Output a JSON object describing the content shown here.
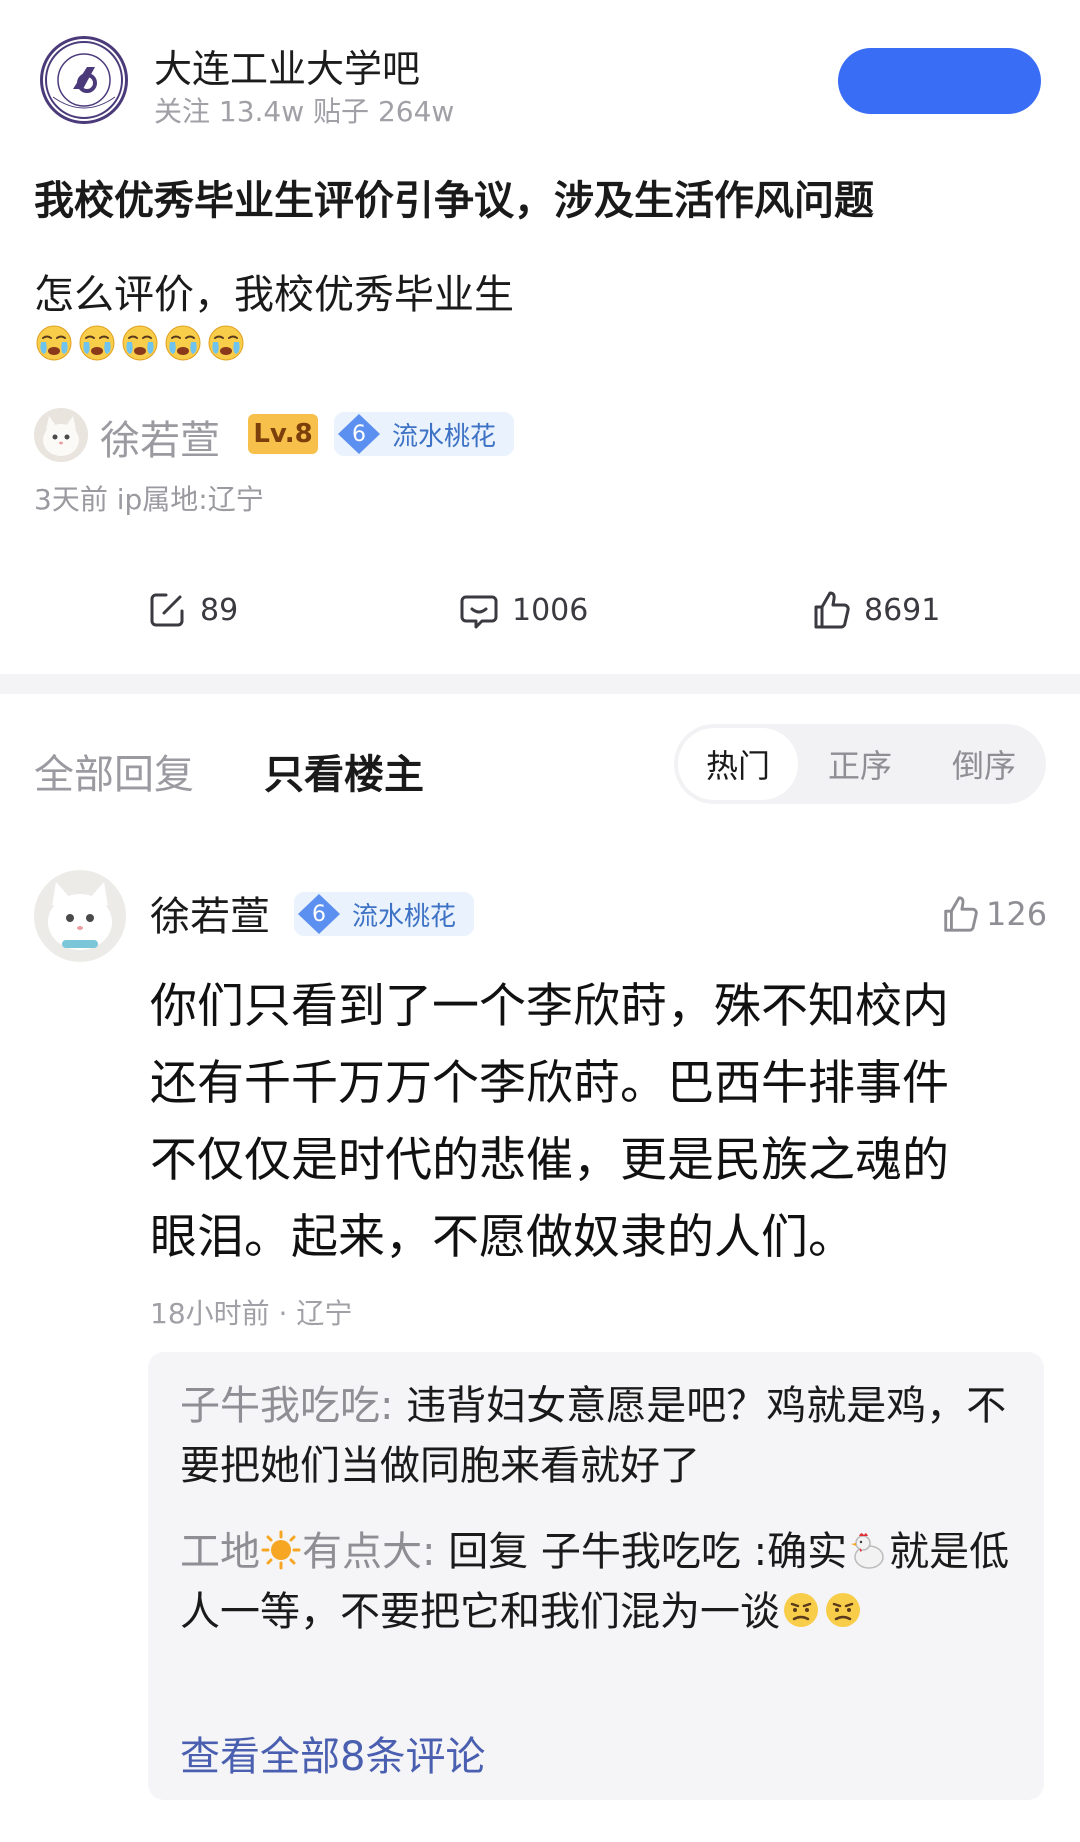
{
  "forum": {
    "name": "大连工业大学吧",
    "stats": "关注 13.4w   贴子 264w",
    "follow_button": "",
    "logo_icon": "school-seal-icon"
  },
  "post": {
    "title": "我校优秀毕业生评价引争议，涉及生活作风问题",
    "body": "怎么评价，我校优秀毕业生",
    "emoji_icon": "crying-face-icon",
    "emoji_count": 5,
    "author": {
      "name": "徐若萱",
      "level": "Lv.8",
      "honor_level": "6",
      "honor_title": "流水桃花"
    },
    "meta": "3天前  ip属地:辽宁",
    "actions": {
      "share_count": "89",
      "comment_count": "1006",
      "like_count": "8691"
    }
  },
  "tabs": {
    "all_replies": "全部回复",
    "op_only": "只看楼主",
    "sort": [
      "热门",
      "正序",
      "倒序"
    ]
  },
  "comment": {
    "author": "徐若萱",
    "honor_level": "6",
    "honor_title": "流水桃花",
    "like_count": "126",
    "text": "你们只看到了一个李欣莳，殊不知校内\n还有千千万万个李欣莳。巴西牛排事件\n不仅仅是时代的悲催，更是民族之魂的\n眼泪。起来，不愿做奴隶的人们。",
    "meta": "18小时前 · 辽宁",
    "replies": [
      {
        "name": "子牛我吃吃:",
        "text": " 违背妇女意愿是吧？鸡就是鸡，不要把她们当做同胞来看就好了"
      },
      {
        "name_part1": "工地",
        "name_part2": "有点大:",
        "text_part1": " 回复 子牛我吃吃 :确实",
        "text_part2": "就是低人一等，不要把它和我们混为一谈"
      }
    ],
    "view_all": "查看全部8条评论"
  },
  "colors": {
    "accent_blue": "#3a6df5",
    "link_blue": "#4a5fb0",
    "badge_gold": "#f7c04a",
    "honor_blue": "#3d72c4"
  }
}
